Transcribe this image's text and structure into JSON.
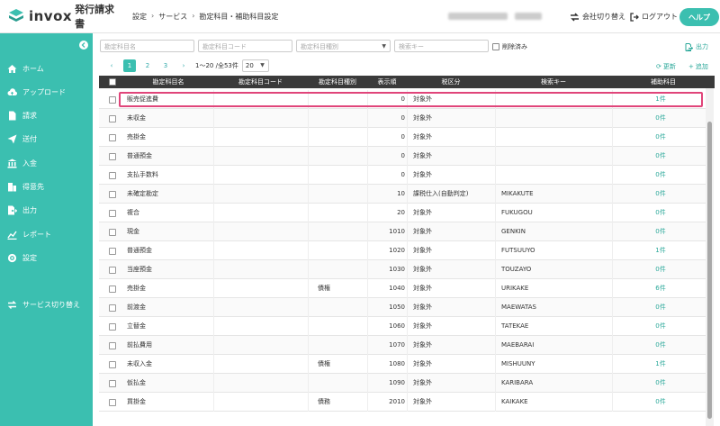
{
  "header": {
    "logo_main": "invox",
    "logo_sub": "発行請求書",
    "breadcrumb": [
      "設定",
      "サービス",
      "勘定科目・補助科目設定"
    ],
    "switch_company": "会社切り替え",
    "logout": "ログアウト",
    "help": "ヘルプ"
  },
  "sidebar": {
    "items": [
      {
        "label": "ホーム",
        "icon": "home-icon"
      },
      {
        "label": "アップロード",
        "icon": "cloud-upload-icon"
      },
      {
        "label": "請求",
        "icon": "document-icon"
      },
      {
        "label": "送付",
        "icon": "send-icon"
      },
      {
        "label": "入金",
        "icon": "bank-icon"
      },
      {
        "label": "得意先",
        "icon": "building-icon"
      },
      {
        "label": "出力",
        "icon": "export-icon"
      },
      {
        "label": "レポート",
        "icon": "chart-icon"
      },
      {
        "label": "設定",
        "icon": "gear-icon"
      }
    ],
    "service_switch": "サービス切り替え"
  },
  "filters": {
    "account_name": "勘定科目名",
    "account_code": "勘定科目コード",
    "account_type": "勘定科目種別",
    "search_key": "検索キー",
    "deleted": "削除済み",
    "output": "出力"
  },
  "pager": {
    "pages": [
      "1",
      "2",
      "3"
    ],
    "range": "1〜20 /全53件",
    "page_size": "20",
    "refresh": "更新",
    "add": "追加"
  },
  "table": {
    "columns": [
      "勘定科目名",
      "勘定科目コード",
      "勘定科目種別",
      "表示順",
      "税区分",
      "検索キー",
      "補助科目"
    ],
    "rows": [
      {
        "name": "販売促進費",
        "code": "",
        "type": "",
        "order": "0",
        "tax": "対象外",
        "key": "",
        "sub": "1件"
      },
      {
        "name": "未収金",
        "code": "",
        "type": "",
        "order": "0",
        "tax": "対象外",
        "key": "",
        "sub": "0件"
      },
      {
        "name": "売掛金",
        "code": "",
        "type": "",
        "order": "0",
        "tax": "対象外",
        "key": "",
        "sub": "0件"
      },
      {
        "name": "普通預金",
        "code": "",
        "type": "",
        "order": "0",
        "tax": "対象外",
        "key": "",
        "sub": "0件"
      },
      {
        "name": "支払手数料",
        "code": "",
        "type": "",
        "order": "0",
        "tax": "対象外",
        "key": "",
        "sub": "0件"
      },
      {
        "name": "未確定勘定",
        "code": "",
        "type": "",
        "order": "10",
        "tax": "課税仕入(自動判定)",
        "key": "MIKAKUTE",
        "sub": "0件"
      },
      {
        "name": "複合",
        "code": "",
        "type": "",
        "order": "20",
        "tax": "対象外",
        "key": "FUKUGOU",
        "sub": "0件"
      },
      {
        "name": "現金",
        "code": "",
        "type": "",
        "order": "1010",
        "tax": "対象外",
        "key": "GENKIN",
        "sub": "0件"
      },
      {
        "name": "普通預金",
        "code": "",
        "type": "",
        "order": "1020",
        "tax": "対象外",
        "key": "FUTSUUYO",
        "sub": "1件"
      },
      {
        "name": "当座預金",
        "code": "",
        "type": "",
        "order": "1030",
        "tax": "対象外",
        "key": "TOUZAYO",
        "sub": "0件"
      },
      {
        "name": "売掛金",
        "code": "",
        "type": "債権",
        "order": "1040",
        "tax": "対象外",
        "key": "URIKAKE",
        "sub": "6件"
      },
      {
        "name": "前渡金",
        "code": "",
        "type": "",
        "order": "1050",
        "tax": "対象外",
        "key": "MAEWATAS",
        "sub": "0件"
      },
      {
        "name": "立替金",
        "code": "",
        "type": "",
        "order": "1060",
        "tax": "対象外",
        "key": "TATEKAE",
        "sub": "0件"
      },
      {
        "name": "前払費用",
        "code": "",
        "type": "",
        "order": "1070",
        "tax": "対象外",
        "key": "MAEBARAI",
        "sub": "0件"
      },
      {
        "name": "未収入金",
        "code": "",
        "type": "債権",
        "order": "1080",
        "tax": "対象外",
        "key": "MISHUUNY",
        "sub": "1件"
      },
      {
        "name": "仮払金",
        "code": "",
        "type": "",
        "order": "1090",
        "tax": "対象外",
        "key": "KARIBARA",
        "sub": "0件"
      },
      {
        "name": "買掛金",
        "code": "",
        "type": "債務",
        "order": "2010",
        "tax": "対象外",
        "key": "KAIKAKE",
        "sub": "0件"
      }
    ]
  },
  "colors": {
    "accent": "#3bbfb0",
    "header_dark": "#3a3a3a",
    "highlight": "#e0457a"
  }
}
